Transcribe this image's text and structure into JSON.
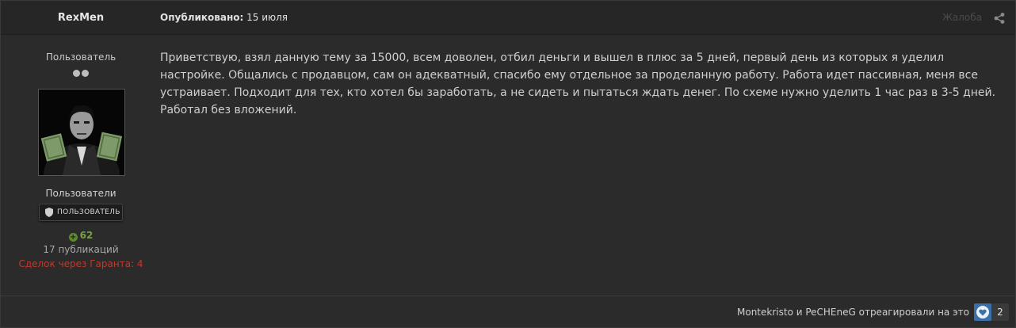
{
  "post": {
    "author": {
      "name": "RexMen",
      "title": "Пользователь",
      "rank_pips": 2,
      "group_name": "Пользователи",
      "group_badge": "ПОЛЬЗОВАТЕЛЬ",
      "reputation": "62",
      "post_count": "17 публикаций",
      "escrow_deals": "Сделок через Гаранта: 4"
    },
    "header": {
      "date_label": "Опубликовано:",
      "date_value": "15 июля",
      "report_label": "Жалоба"
    },
    "body": "Приветствую, взял данную тему за 15000, всем доволен, отбил деньги и вышел в плюс за 5 дней, первый день из которых я уделил настройке. Общались с продавцом, сам он адекватный, спасибо ему отдельное за проделанную работу. Работа идет пассивная, меня все устраивает. Подходит для тех, кто хотел бы заработать, а не сидеть и пытаться ждать денег. По схеме нужно уделить 1 час раз в 3-5 дней. Работал без вложений.",
    "footer": {
      "reactions_text": "Montekristo и PeCHEneG отреагировали на это",
      "reaction_icon": "heart-icon",
      "reaction_count": "2"
    }
  },
  "colors": {
    "background": "#2b2b2b",
    "header_bg": "#262626",
    "reputation_green": "#78a042",
    "escrow_red": "#c0392b",
    "reaction_blue": "#3b6fa8"
  }
}
